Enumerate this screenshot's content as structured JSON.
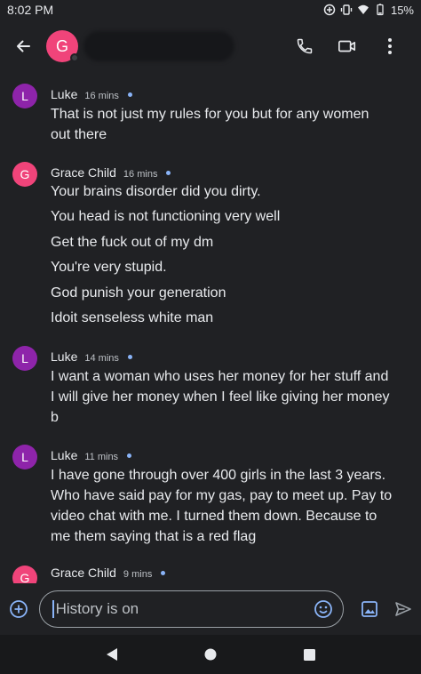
{
  "status_bar": {
    "time": "8:02 PM",
    "battery": "15%"
  },
  "header": {
    "contact_initial": "G",
    "avatar_color": "#f0447a"
  },
  "messages": [
    {
      "sender": "Luke",
      "initial": "L",
      "time": "16 mins",
      "lines": [
        "That is not just my rules for you but for any women",
        "out there"
      ]
    },
    {
      "sender": "Grace Child",
      "initial": "G",
      "time": "16 mins",
      "lines": [
        "Your brains disorder did you dirty.",
        "You head is not functioning very well",
        "Get the fuck out of my dm",
        "You're very stupid.",
        "God punish your generation",
        "Idoit senseless white man"
      ]
    },
    {
      "sender": "Luke",
      "initial": "L",
      "time": "14 mins",
      "lines": [
        "I want a woman who uses her money for her stuff and",
        "I will give her money when I feel like giving her money",
        "b"
      ]
    },
    {
      "sender": "Luke",
      "initial": "L",
      "time": "11 mins",
      "lines": [
        "I have gone through over 400 girls in the last 3 years.",
        "Who have said pay for my gas, pay to meet up. Pay to",
        "video chat with me. I turned them down. Because to",
        "me them saying that is a red flag"
      ]
    },
    {
      "sender": "Grace Child",
      "initial": "G",
      "time": "9 mins",
      "lines": []
    }
  ],
  "compose": {
    "placeholder": "History is on"
  },
  "colors": {
    "luke_avatar": "#8e24aa",
    "grace_avatar": "#f0447a",
    "background": "#202124",
    "unread_dot": "#8ab4f8"
  }
}
